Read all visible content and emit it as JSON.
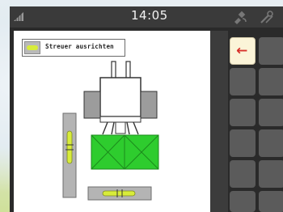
{
  "status": {
    "time": "14:05",
    "icons": [
      "signal-icon",
      "gps-satellite-icon",
      "tools-icon"
    ]
  },
  "screen": {
    "title": "Streuer ausrichten",
    "header_icon": "spirit-level-icon"
  },
  "illustration": {
    "level_vertical_icon": "vertical-spirit-level-icon",
    "level_horizontal_icon": "horizontal-spirit-level-icon",
    "tractor_icon": "tractor-top-view-icon",
    "spreader_icon": "spreader-hopper-icon"
  },
  "softkeys": {
    "back_icon": "back-arrow-icon",
    "back_symbol": "←"
  },
  "colors": {
    "accent_green": "#2ecc2e",
    "level_bubble": "#d8ec3a",
    "back_arrow": "#d7322b",
    "softkey_bg": "#5b5b5b"
  }
}
